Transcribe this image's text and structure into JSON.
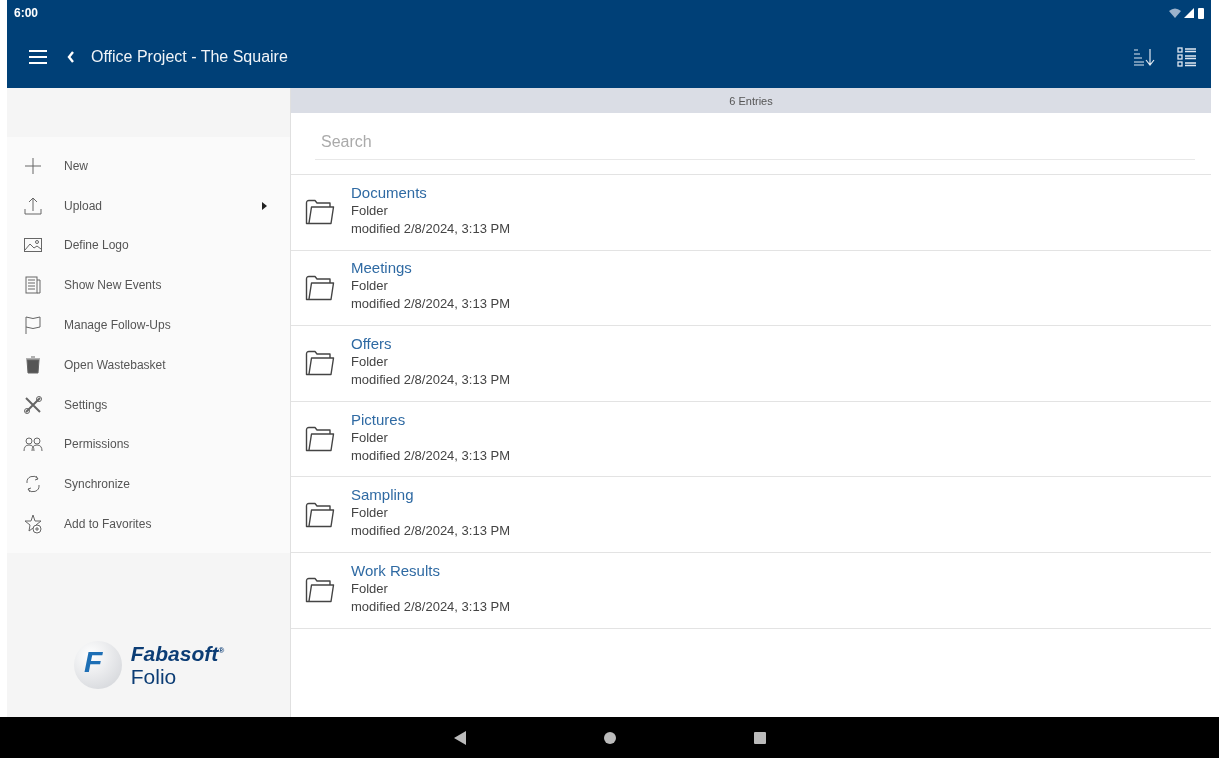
{
  "status_bar": {
    "time": "6:00"
  },
  "app_bar": {
    "title": "Office Project - The Squaire"
  },
  "sidebar": {
    "items": [
      {
        "label": "New",
        "has_submenu": false
      },
      {
        "label": "Upload",
        "has_submenu": true
      },
      {
        "label": "Define Logo",
        "has_submenu": false
      },
      {
        "label": "Show New Events",
        "has_submenu": false
      },
      {
        "label": "Manage Follow-Ups",
        "has_submenu": false
      },
      {
        "label": "Open Wastebasket",
        "has_submenu": false
      },
      {
        "label": "Settings",
        "has_submenu": false
      },
      {
        "label": "Permissions",
        "has_submenu": false
      },
      {
        "label": "Synchronize",
        "has_submenu": false
      },
      {
        "label": "Add to Favorites",
        "has_submenu": false
      }
    ],
    "logo": {
      "brand": "Fabasoft",
      "product": "Folio",
      "mark": "F",
      "registered": "®"
    }
  },
  "list": {
    "count": "6 Entries",
    "search": {
      "placeholder": "Search"
    },
    "rows": [
      {
        "name": "Documents",
        "type": "Folder",
        "modified": "modified 2/8/2024, 3:13 PM"
      },
      {
        "name": "Meetings",
        "type": "Folder",
        "modified": "modified 2/8/2024, 3:13 PM"
      },
      {
        "name": "Offers",
        "type": "Folder",
        "modified": "modified 2/8/2024, 3:13 PM"
      },
      {
        "name": "Pictures",
        "type": "Folder",
        "modified": "modified 2/8/2024, 3:13 PM"
      },
      {
        "name": "Sampling",
        "type": "Folder",
        "modified": "modified 2/8/2024, 3:13 PM"
      },
      {
        "name": "Work Results",
        "type": "Folder",
        "modified": "modified 2/8/2024, 3:13 PM"
      }
    ]
  }
}
